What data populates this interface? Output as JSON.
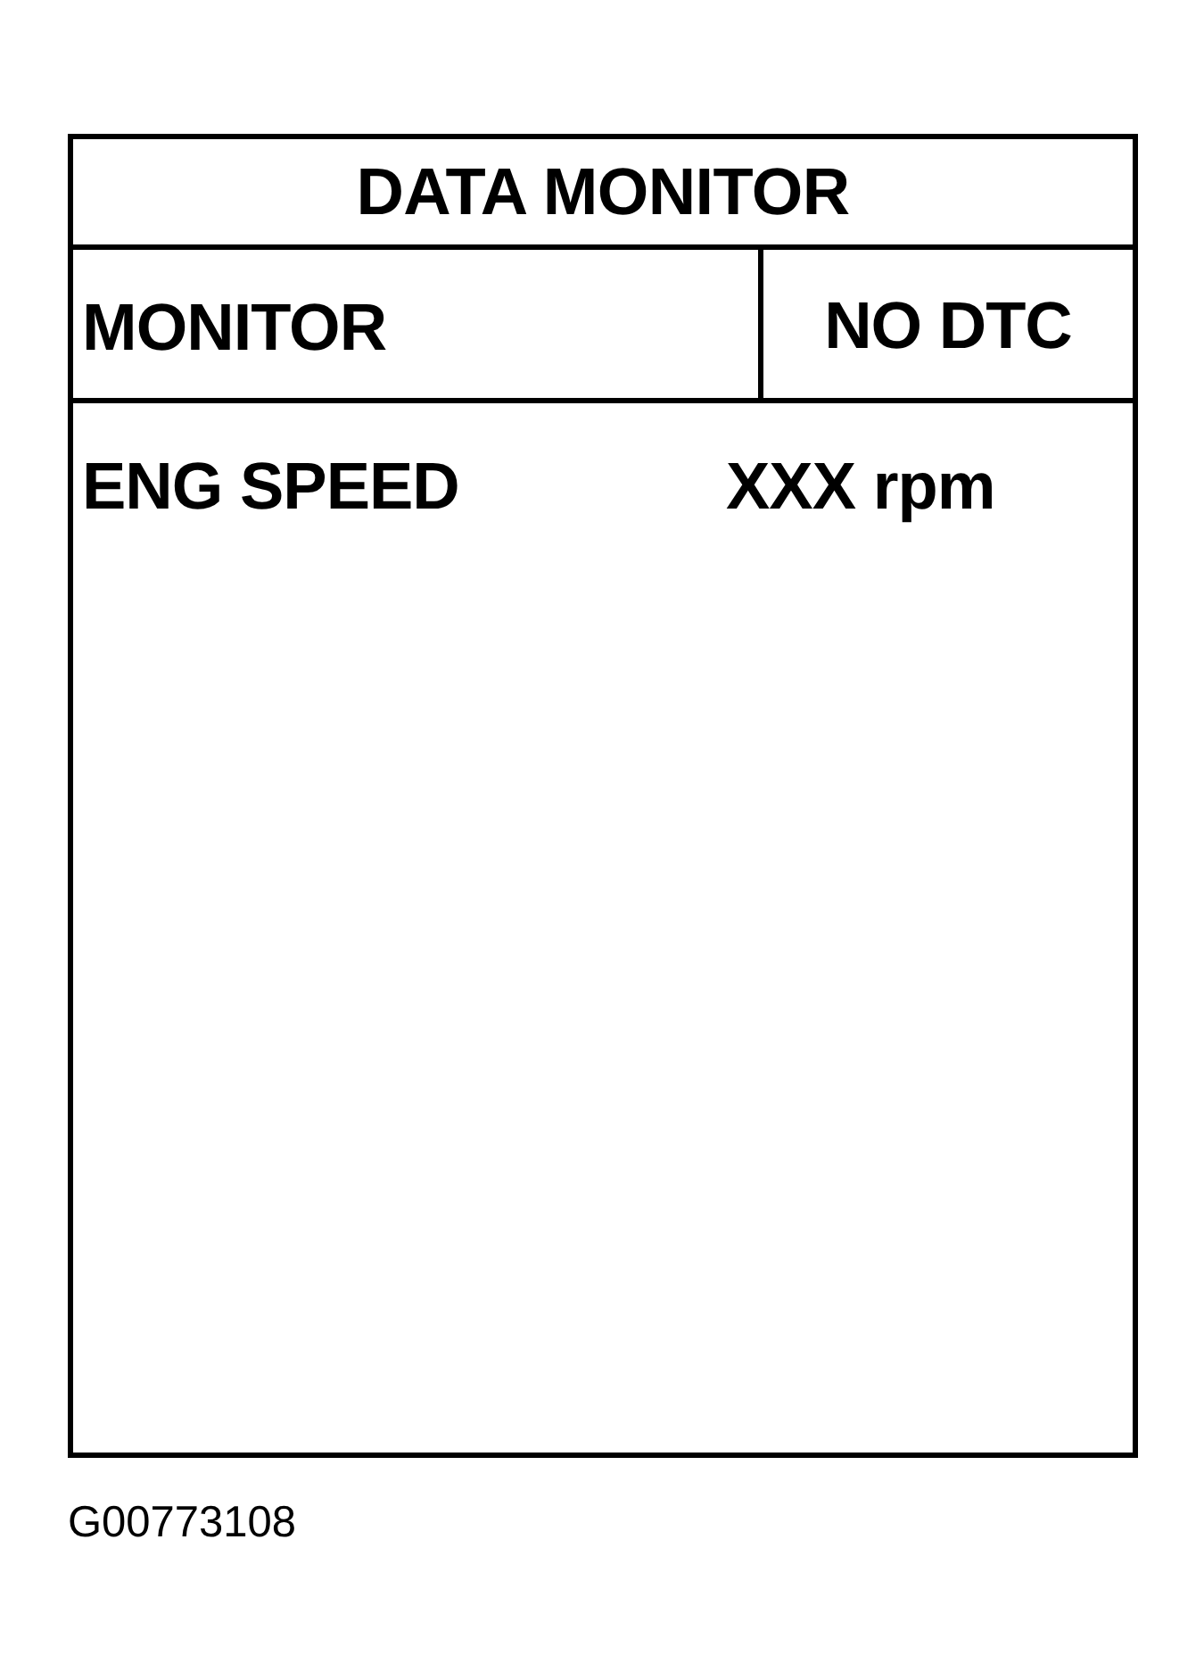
{
  "title": "DATA MONITOR",
  "header": {
    "label": "MONITOR",
    "status": "NO DTC"
  },
  "rows": [
    {
      "name": "ENG SPEED",
      "value": "XXX rpm"
    }
  ],
  "figure_id": "G00773108"
}
